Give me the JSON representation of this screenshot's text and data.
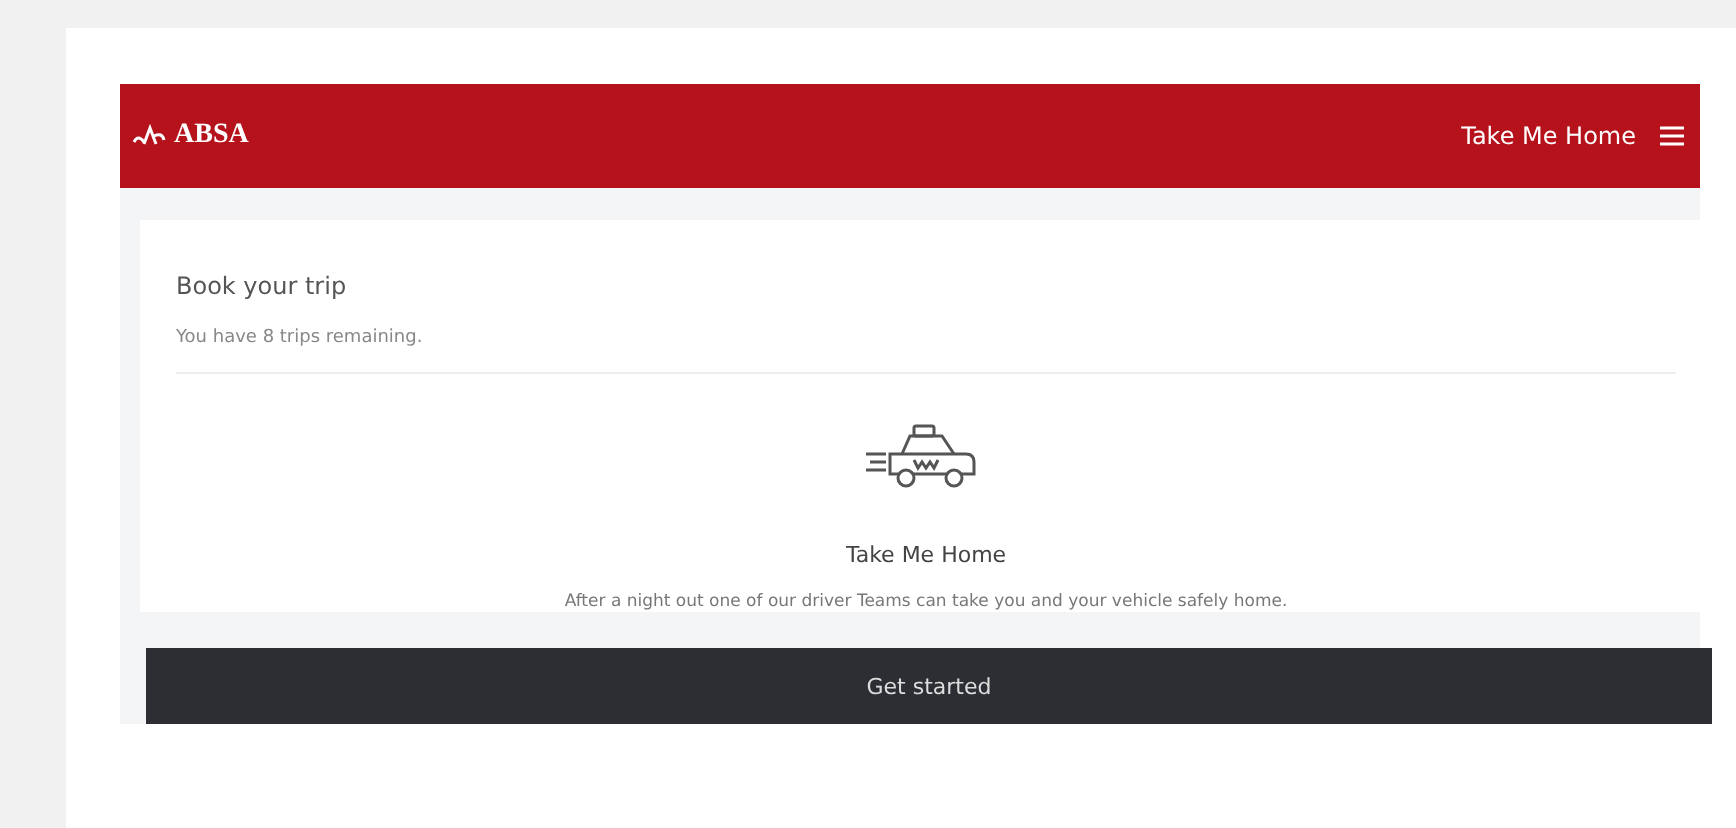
{
  "header": {
    "logo": "ABSA",
    "title": "Take Me Home"
  },
  "card": {
    "title": "Book your trip",
    "subtitle": "You have 8 trips remaining.",
    "service_title": "Take Me Home",
    "description": "After a night out one of our driver Teams can take you and your vehicle safely home.",
    "button": "Get started"
  }
}
